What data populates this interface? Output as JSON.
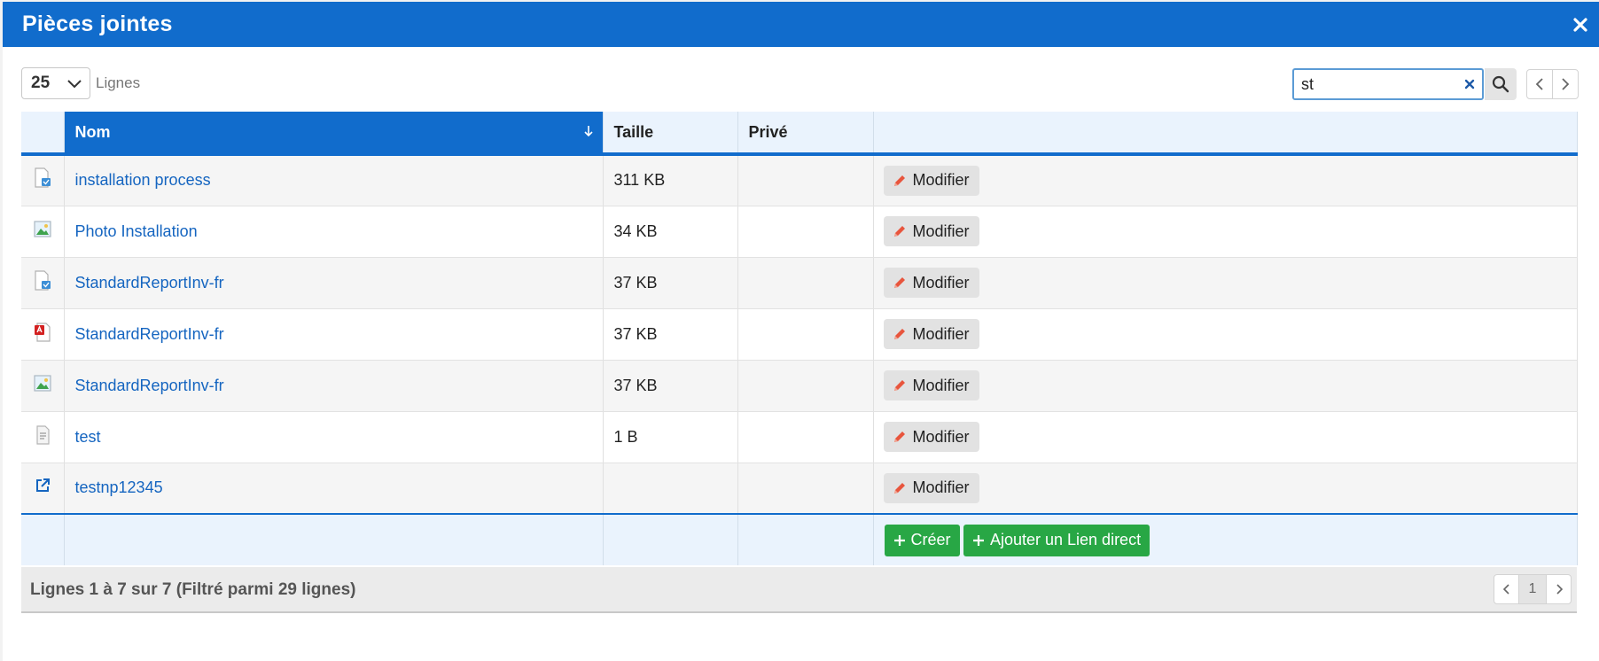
{
  "dialog": {
    "title": "Pièces jointes"
  },
  "toolbar": {
    "page_length": "25",
    "page_length_label": "Lignes",
    "search_value": "st"
  },
  "table": {
    "columns": [
      "",
      "Nom",
      "Taille",
      "Privé",
      ""
    ],
    "rows": [
      {
        "icon": "document-icon",
        "name": "installation process",
        "size": "311 KB",
        "private": "",
        "action": "Modifier"
      },
      {
        "icon": "image-icon",
        "name": "Photo Installation",
        "size": "34 KB",
        "private": "",
        "action": "Modifier"
      },
      {
        "icon": "document-icon",
        "name": "StandardReportInv-fr",
        "size": "37 KB",
        "private": "",
        "action": "Modifier"
      },
      {
        "icon": "pdf-icon",
        "name": "StandardReportInv-fr",
        "size": "37 KB",
        "private": "",
        "action": "Modifier"
      },
      {
        "icon": "image-icon",
        "name": "StandardReportInv-fr",
        "size": "37 KB",
        "private": "",
        "action": "Modifier"
      },
      {
        "icon": "text-file-icon",
        "name": "test",
        "size": "1 B",
        "private": "",
        "action": "Modifier"
      },
      {
        "icon": "external-link-icon",
        "name": "testnp12345",
        "size": "",
        "private": "",
        "action": "Modifier"
      }
    ],
    "footer": {
      "create_label": "Créer",
      "add_link_label": "Ajouter un Lien direct"
    }
  },
  "info": {
    "text": "Lignes 1 à 7 sur 7 (Filtré parmi 29 lignes)",
    "current_page": "1"
  },
  "colors": {
    "header_blue": "#116ccc",
    "link_blue": "#1565c0",
    "green": "#28a745",
    "pencil": "#e8553d"
  }
}
